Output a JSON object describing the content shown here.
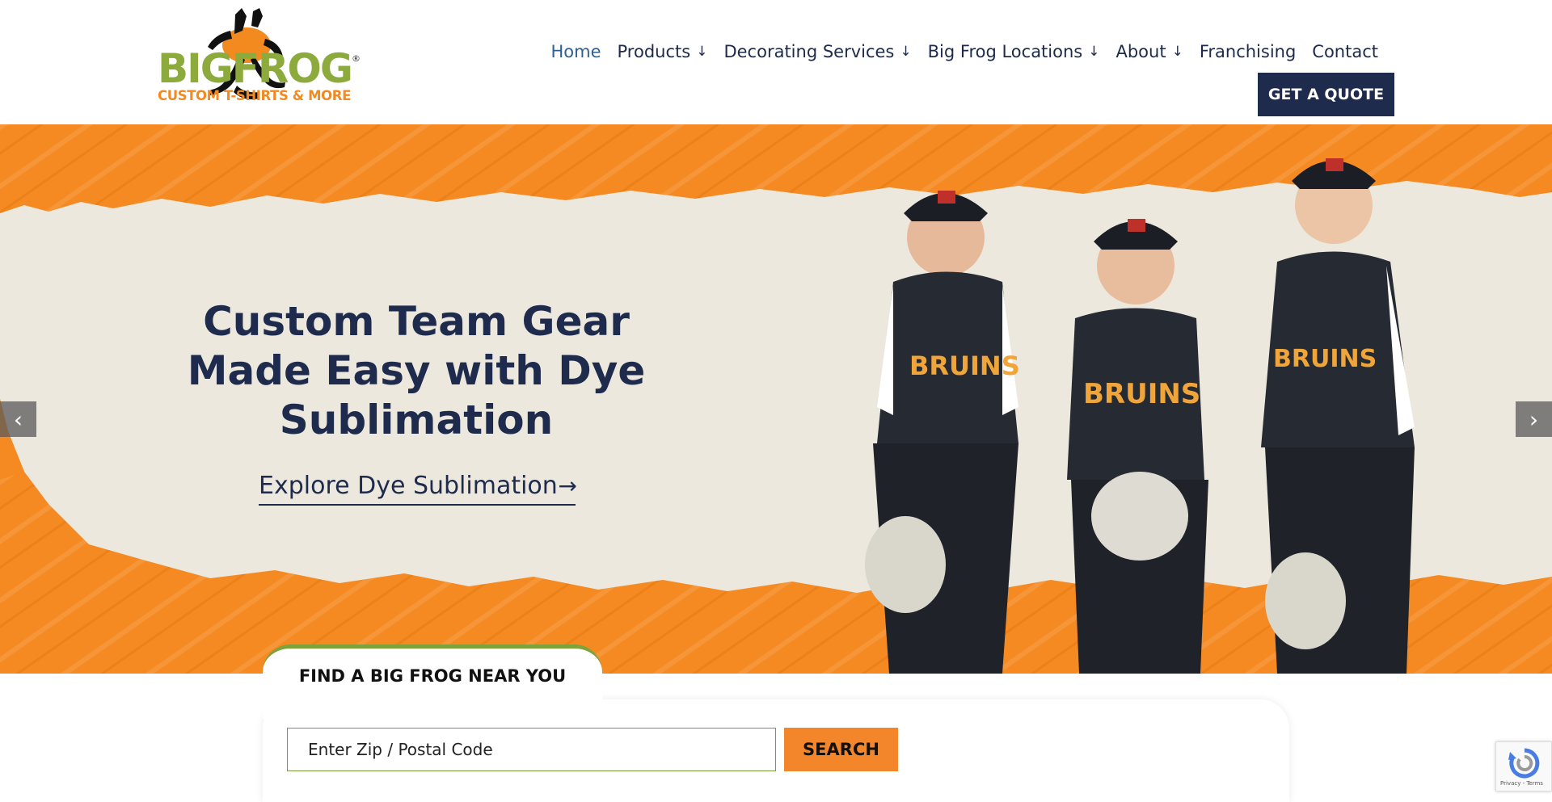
{
  "logo": {
    "wordmark": "BIGFROG",
    "tagline": "CUSTOM T-SHIRTS & MORE",
    "registered": "®"
  },
  "nav": {
    "items": [
      {
        "label": "Home",
        "active": true,
        "dropdown": false
      },
      {
        "label": "Products",
        "active": false,
        "dropdown": true
      },
      {
        "label": "Decorating Services",
        "active": false,
        "dropdown": true
      },
      {
        "label": "Big Frog Locations",
        "active": false,
        "dropdown": true
      },
      {
        "label": "About",
        "active": false,
        "dropdown": true
      },
      {
        "label": "Franchising",
        "active": false,
        "dropdown": false
      },
      {
        "label": "Contact",
        "active": false,
        "dropdown": false
      }
    ],
    "dropdown_glyph": "↓",
    "quote_button": "GET A QUOTE"
  },
  "hero": {
    "headline": "Custom Team Gear Made Easy with Dye Sublimation",
    "cta": "Explore Dye Sublimation",
    "cta_icon": "arrow-right-icon",
    "prev_icon": "chevron-left-icon",
    "next_icon": "chevron-right-icon",
    "jersey_text": "BRUINS"
  },
  "locator": {
    "title": "FIND A BIG FROG NEAR YOU",
    "placeholder": "Enter Zip / Postal Code",
    "search_label": "SEARCH"
  },
  "recaptcha": {
    "label": "Privacy - Terms"
  },
  "colors": {
    "navy": "#1e2b4d",
    "orange": "#f58a22",
    "green": "#8cab3c",
    "active_nav": "#2f5f93",
    "cream": "#ece8de"
  }
}
